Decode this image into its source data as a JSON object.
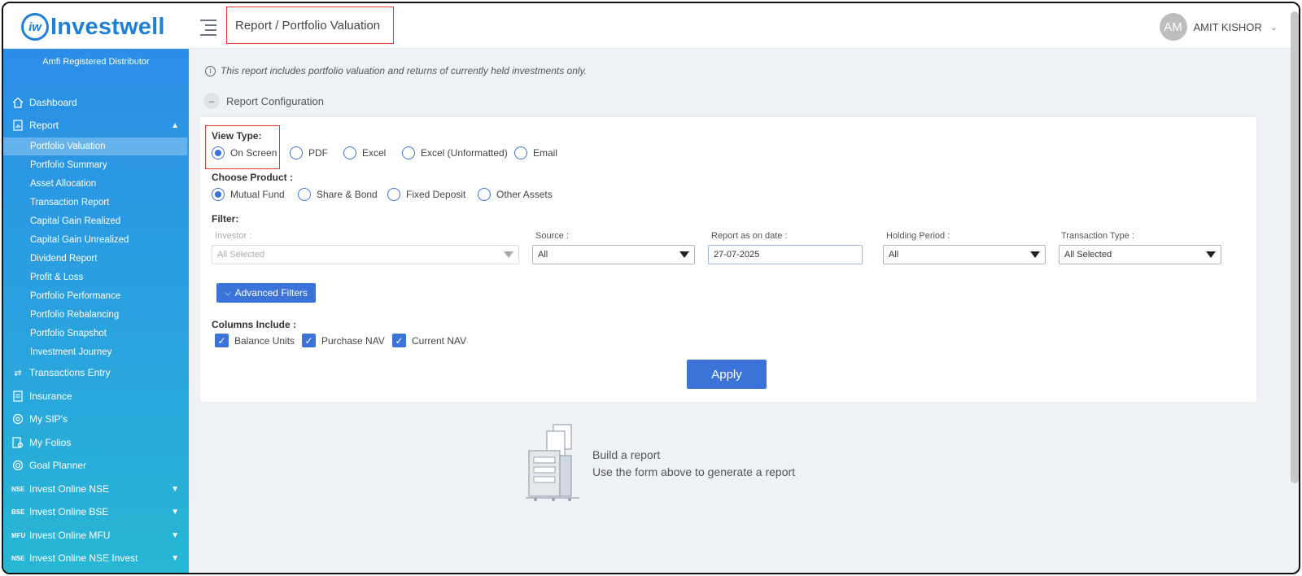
{
  "app": {
    "logo_mark": "iw",
    "logo_text": "Investwell"
  },
  "header": {
    "breadcrumb": "Report / Portfolio Valuation",
    "avatar_initials": "AM",
    "user_name": "AMIT KISHOR"
  },
  "sidebar": {
    "subtitle": "Amfi Registered Distributor",
    "items": [
      {
        "label": "Dashboard",
        "icon": "home-icon"
      },
      {
        "label": "Report",
        "icon": "report-icon"
      },
      {
        "label": "Transactions Entry",
        "icon": "transfer-icon"
      },
      {
        "label": "Insurance",
        "icon": "document-icon"
      },
      {
        "label": "My SIP's",
        "icon": "sip-icon"
      },
      {
        "label": "My Folios",
        "icon": "folio-icon"
      },
      {
        "label": "Goal Planner",
        "icon": "target-icon"
      },
      {
        "label": "Invest Online NSE",
        "tag": "NSE"
      },
      {
        "label": "Invest Online BSE",
        "tag": "BSE"
      },
      {
        "label": "Invest Online MFU",
        "tag": "MFU"
      },
      {
        "label": "Invest Online NSE Invest",
        "tag": "NSE"
      }
    ],
    "report_subitems": [
      "Portfolio Valuation",
      "Portfolio Summary",
      "Asset Allocation",
      "Transaction Report",
      "Capital Gain Realized",
      "Capital Gain Unrealized",
      "Dividend Report",
      "Profit & Loss",
      "Portfolio Performance",
      "Portfolio Rebalancing",
      "Portfolio Snapshot",
      "Investment Journey"
    ]
  },
  "content": {
    "info": "This report includes portfolio valuation and returns of currently held investments only.",
    "config_title": "Report Configuration",
    "view_type": {
      "label": "View Type:",
      "options": [
        "On Screen",
        "PDF",
        "Excel",
        "Excel (Unformatted)",
        "Email"
      ],
      "selected": "On Screen"
    },
    "product": {
      "label": "Choose Product :",
      "options": [
        "Mutual Fund",
        "Share & Bond",
        "Fixed Deposit",
        "Other Assets"
      ],
      "selected": "Mutual Fund"
    },
    "filter": {
      "label": "Filter:",
      "investor": {
        "label": "Investor :",
        "value": "All Selected"
      },
      "source": {
        "label": "Source :",
        "value": "All"
      },
      "date": {
        "label": "Report as on date :",
        "value": "27-07-2025"
      },
      "holding": {
        "label": "Holding Period :",
        "value": "All"
      },
      "txn_type": {
        "label": "Transaction Type :",
        "value": "All Selected"
      }
    },
    "advanced_filters": "Advanced Filters",
    "columns": {
      "label": "Columns Include :",
      "options": [
        "Balance Units",
        "Purchase NAV",
        "Current NAV"
      ]
    },
    "apply": "Apply",
    "empty": {
      "title": "Build a report",
      "subtitle": "Use the form above to generate a report"
    }
  },
  "colors": {
    "accent": "#3b73d9",
    "brand": "#1e7fd6",
    "highlight": "#e53935"
  }
}
